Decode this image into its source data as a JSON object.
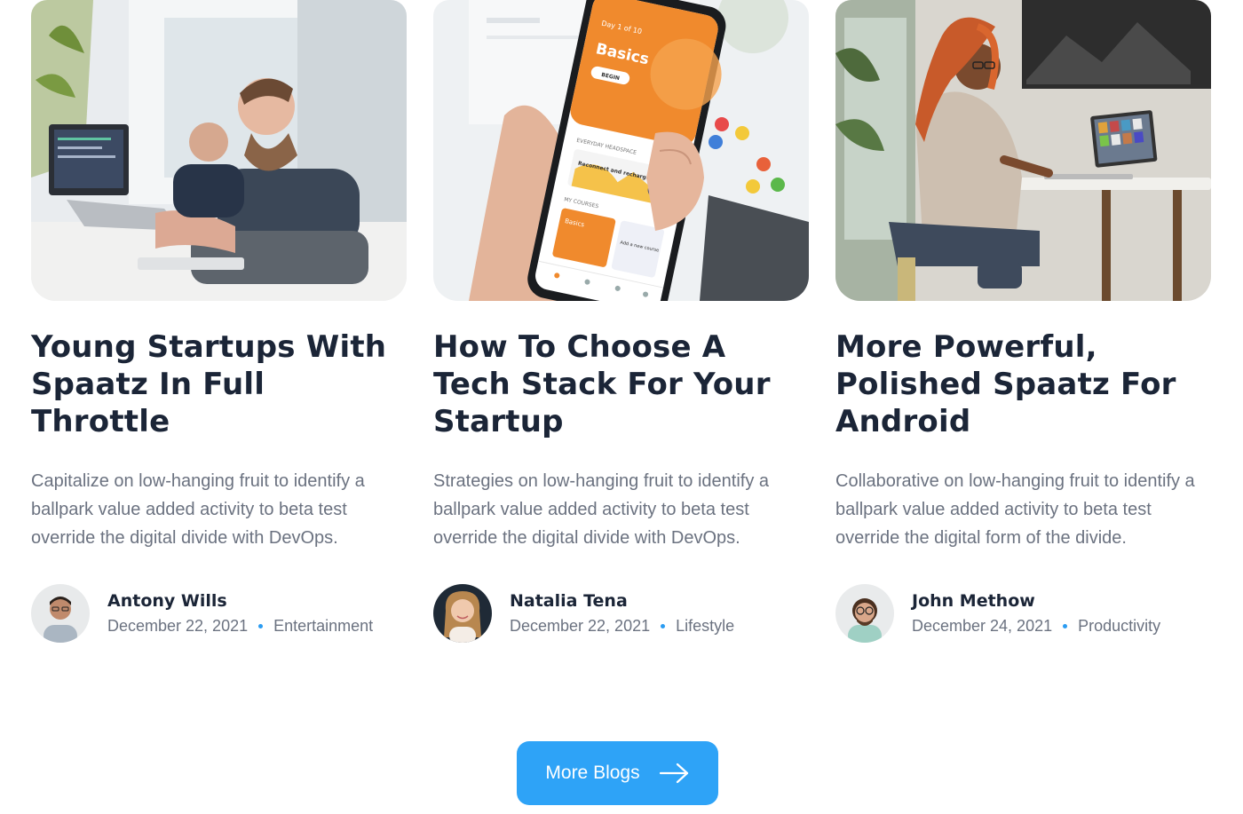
{
  "posts": [
    {
      "title": "Young Startups With Spaatz In Full Throttle",
      "excerpt": "Capitalize on low-hanging fruit to identify a ballpark value added activity to beta test override the digital divide with DevOps.",
      "author": "Antony Wills",
      "date": "December 22, 2021",
      "category": "Entertainment"
    },
    {
      "title": "How To Choose A Tech Stack For Your Startup",
      "excerpt": "Strategies on low-hanging fruit to identify a ballpark value added activity to beta test override the digital divide with DevOps.",
      "author": "Natalia Tena",
      "date": "December 22, 2021",
      "category": "Lifestyle"
    },
    {
      "title": "More Powerful, Polished Spaatz For Android",
      "excerpt": "Collaborative on low-hanging fruit to identify a ballpark value added activity to beta test override the digital form of the divide.",
      "author": "John Methow",
      "date": "December 24, 2021",
      "category": "Productivity"
    }
  ],
  "phone_screen": {
    "day": "Day 1 of 10",
    "heading": "Basics",
    "begin": "BEGIN",
    "section": "EVERYDAY HEADSPACE",
    "card": "Reconnect and recharge",
    "courses": "MY COURSES",
    "course": "Basics",
    "add": "Add a new course"
  },
  "more_button": {
    "label": "More Blogs",
    "icon": "arrow-right-icon"
  },
  "colors": {
    "accent": "#2ea3f7",
    "title": "#1b2537",
    "text": "#6b7280",
    "dot": "#2b9cf2"
  }
}
